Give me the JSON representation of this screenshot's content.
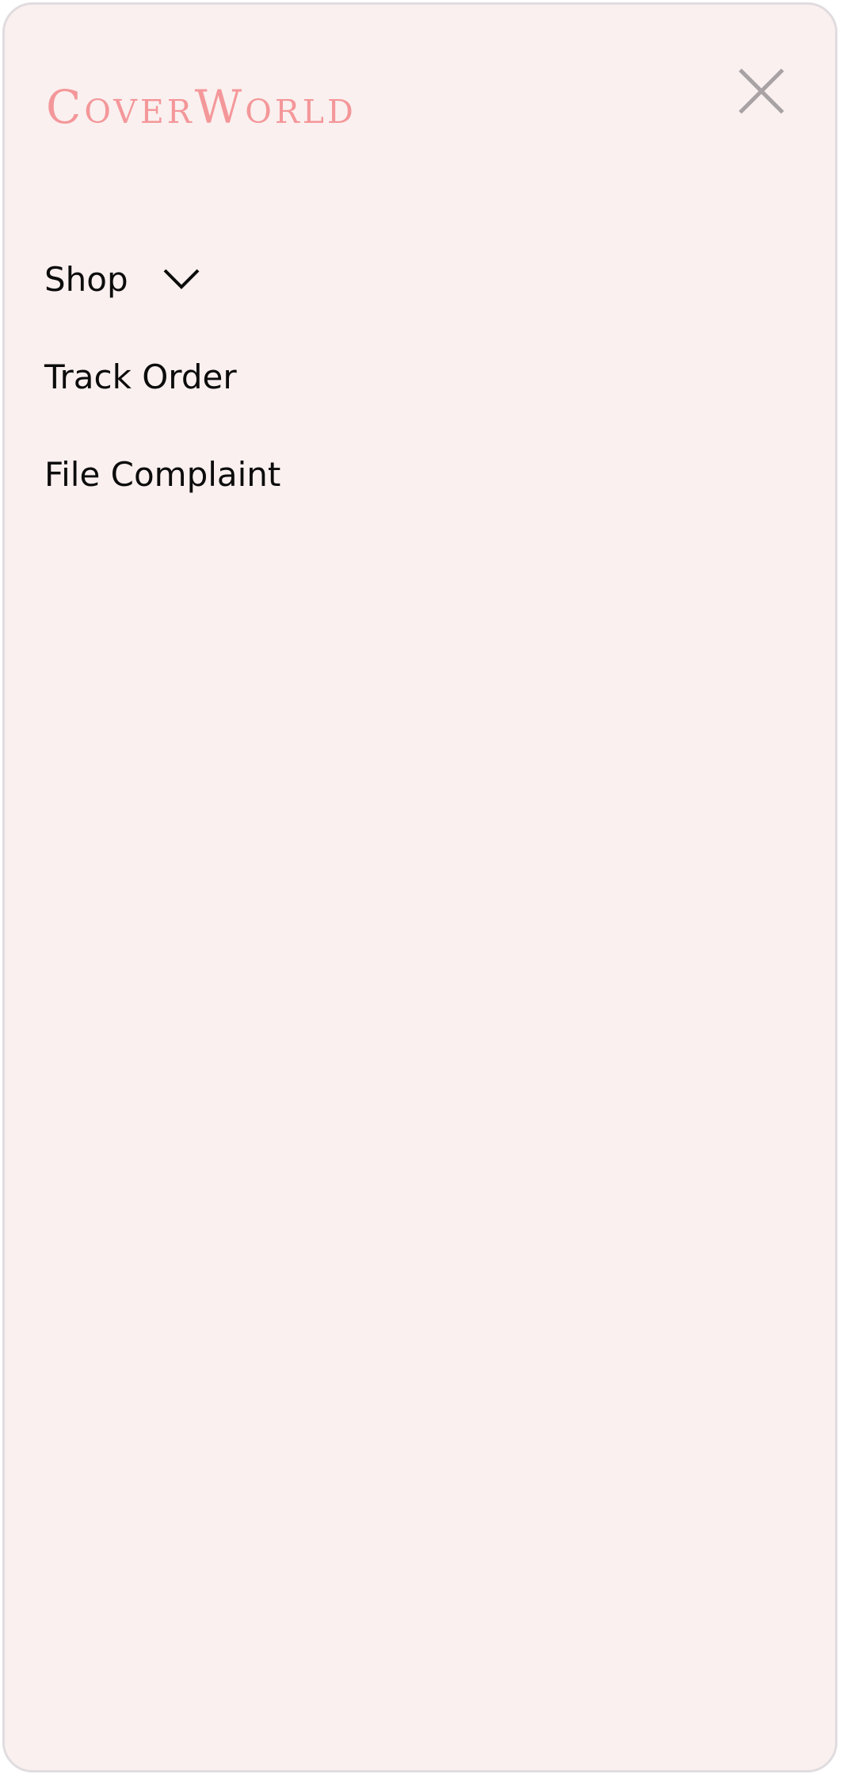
{
  "brand": {
    "logo_text": "CoverWorld",
    "logo_color": "#f4979a"
  },
  "header": {
    "close_icon": "close-icon"
  },
  "nav": {
    "items": [
      {
        "label": "Shop",
        "has_dropdown": true,
        "icon": "chevron-down-icon"
      },
      {
        "label": "Track Order"
      },
      {
        "label": "File Complaint"
      }
    ]
  },
  "colors": {
    "background": "#faf0ef",
    "text": "#0c0c0c",
    "close_icon": "#a8a2a4"
  }
}
